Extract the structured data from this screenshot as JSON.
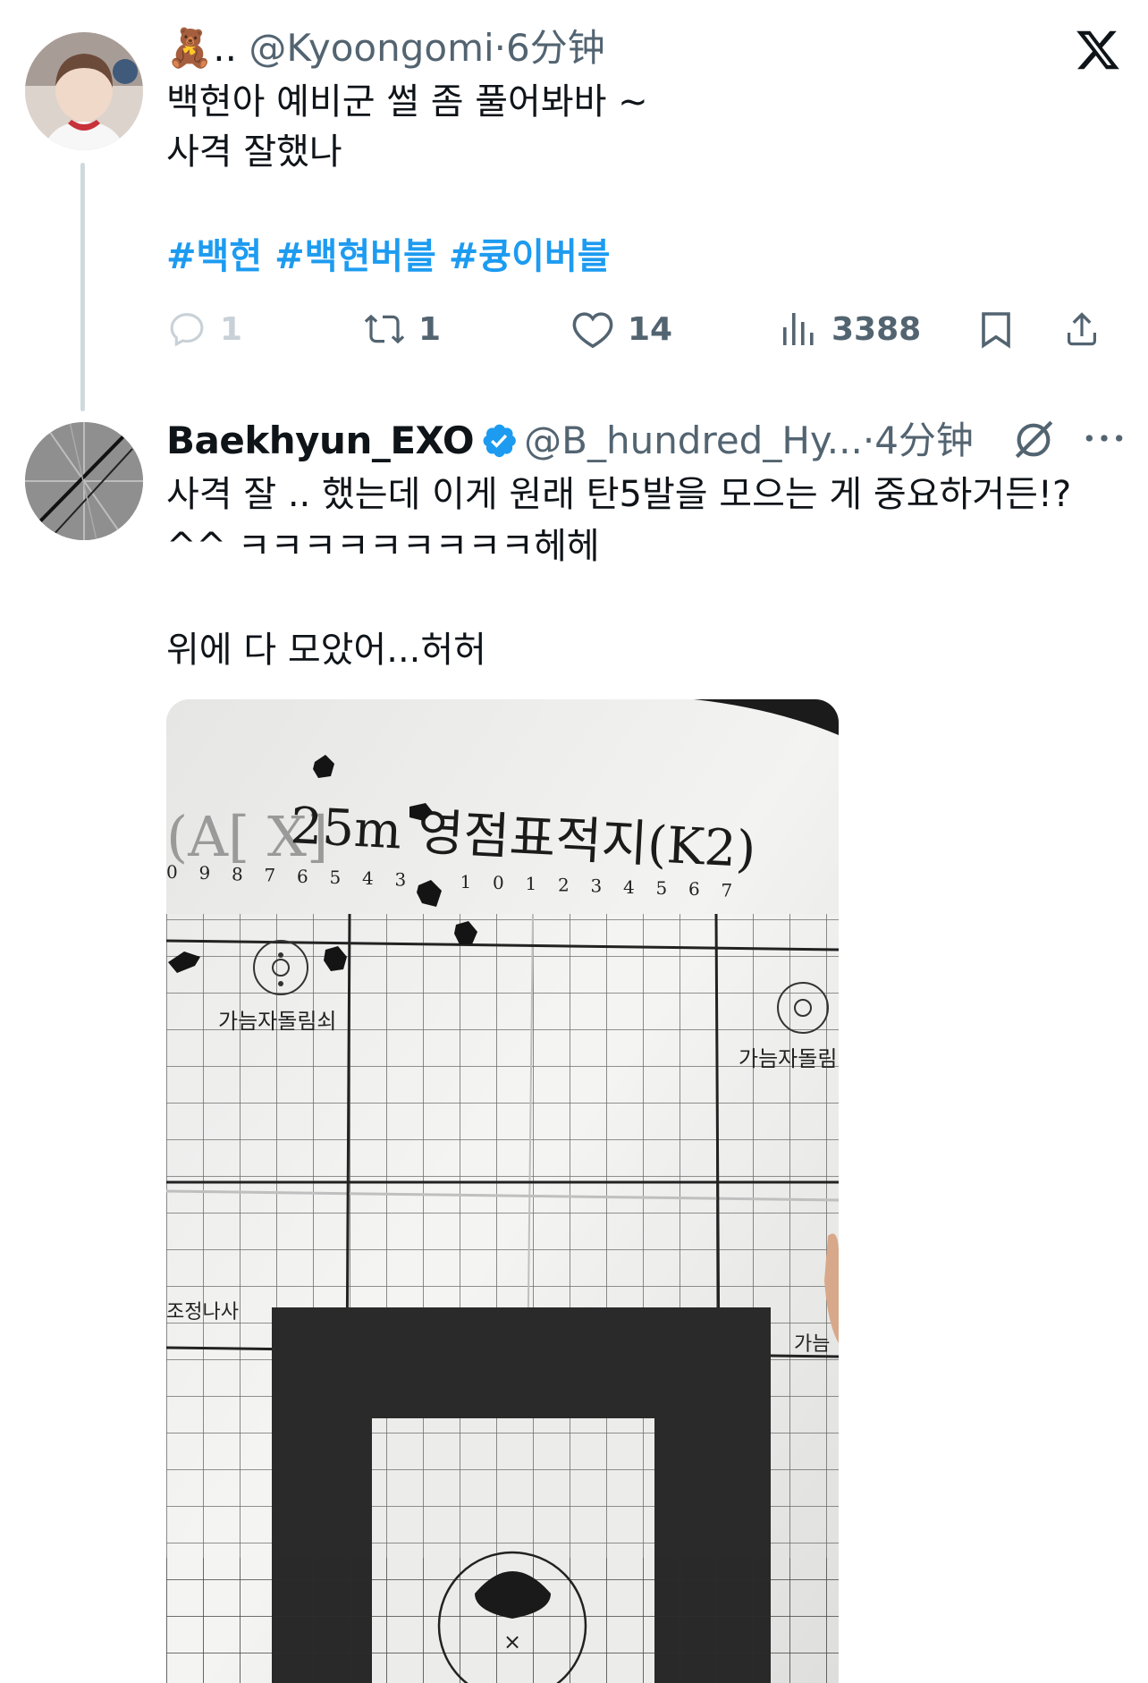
{
  "app": {
    "logo_icon": "x-logo-icon"
  },
  "tweet1": {
    "display_name_emoji": "🧸..",
    "handle": "@Kyoongomi",
    "separator": "·",
    "time": "6分钟",
    "text": "백현아 예비군 썰 좀 풀어봐바 ~\n사격 잘했나",
    "hashtags": [
      "#백현",
      "#백현버블",
      "#큥이버블"
    ],
    "actions": {
      "reply_count": "1",
      "retweet_count": "1",
      "like_count": "14",
      "view_count": "3388"
    }
  },
  "tweet2": {
    "display_name": "Baekhyun_EXO",
    "handle": "@B_hundred_Hy...",
    "separator": "·",
    "time": "4分钟",
    "text": "사격 잘 .. 했는데 이게 원래 탄5발을 모으는 게 중요하거든!?\n^^ ㅋㅋㅋㅋㅋㅋㅋㅋㅋ헤헤\n\n위에 다 모았어...허허",
    "photo": {
      "title": "25m 영점표적지(K2)",
      "header_left": "(A[ X]",
      "scale_numbers": [
        "0",
        "9",
        "8",
        "7",
        "6",
        "5",
        "4",
        "3",
        "",
        "1",
        "0",
        "1",
        "2",
        "3",
        "4",
        "5",
        "6",
        "7"
      ],
      "label_left": "가늠자돌림쇠",
      "label_right": "가늠자돌림",
      "label_bottom_left": "조정나사",
      "label_bottom_right": "가늠",
      "center_mark": "×"
    }
  },
  "colors": {
    "accent": "#1d9bf0",
    "muted": "#536471",
    "thread_line": "#cfd9de",
    "text": "#0f1419"
  }
}
